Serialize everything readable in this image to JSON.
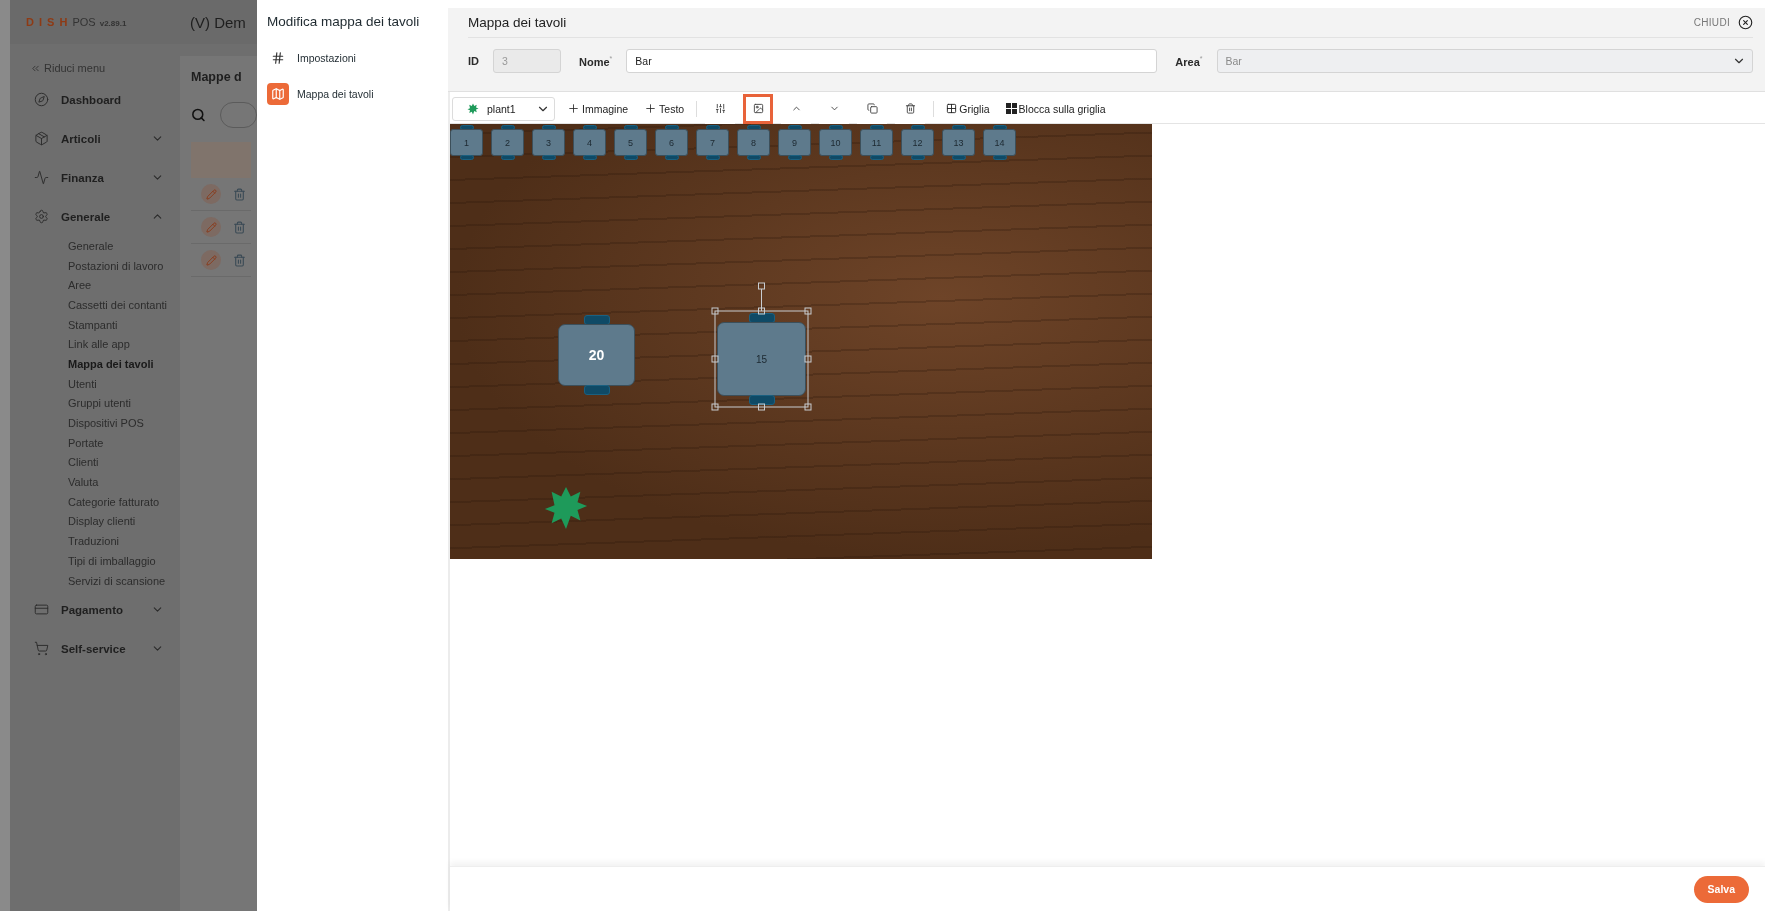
{
  "app": {
    "logo": {
      "brand": "D I S H",
      "product": "POS",
      "version": "v2.89.1"
    },
    "header_title": "(V) Dem",
    "sidebar": {
      "collapse": "Riduci menu",
      "items": [
        {
          "kind": "link",
          "label": "Dashboard"
        },
        {
          "kind": "group",
          "label": "Articoli",
          "expanded": false
        },
        {
          "kind": "group",
          "label": "Finanza",
          "expanded": false
        },
        {
          "kind": "group",
          "label": "Generale",
          "expanded": true,
          "children": [
            {
              "label": "Generale",
              "selected": false
            },
            {
              "label": "Postazioni di lavoro",
              "selected": false
            },
            {
              "label": "Aree",
              "selected": false
            },
            {
              "label": "Cassetti dei contanti",
              "selected": false
            },
            {
              "label": "Stampanti",
              "selected": false
            },
            {
              "label": "Link alle app",
              "selected": false
            },
            {
              "label": "Mappa dei tavoli",
              "selected": true
            },
            {
              "label": "Utenti",
              "selected": false
            },
            {
              "label": "Gruppi utenti",
              "selected": false
            },
            {
              "label": "Dispositivi POS",
              "selected": false
            },
            {
              "label": "Portate",
              "selected": false
            },
            {
              "label": "Clienti",
              "selected": false
            },
            {
              "label": "Valuta",
              "selected": false
            },
            {
              "label": "Categorie fatturato",
              "selected": false
            },
            {
              "label": "Display clienti",
              "selected": false
            },
            {
              "label": "Traduzioni",
              "selected": false
            },
            {
              "label": "Tipi di imballaggio",
              "selected": false
            },
            {
              "label": "Servizi di scansione",
              "selected": false
            }
          ]
        },
        {
          "kind": "group",
          "label": "Pagamento",
          "expanded": false
        },
        {
          "kind": "group",
          "label": "Self-service",
          "expanded": false
        }
      ]
    },
    "page": {
      "title": "Mappe d",
      "rows": [
        {
          "kind": "item"
        },
        {
          "kind": "item"
        },
        {
          "kind": "item"
        }
      ]
    }
  },
  "modal": {
    "title": "Modifica mappa dei tavoli",
    "nav": [
      {
        "label": "Impostazioni",
        "selected": false
      },
      {
        "label": "Mappa dei tavoli",
        "selected": true
      }
    ]
  },
  "editor": {
    "title": "Mappa dei tavoli",
    "close": "CHIUDI",
    "fields": [
      {
        "kind": "input",
        "label": "ID",
        "value": "3",
        "disabled": true
      },
      {
        "kind": "input",
        "label": "Nome$^{*}$",
        "value": "Bar",
        "disabled": false
      },
      {
        "kind": "select",
        "label": "Area$^{*}$",
        "value": "Bar",
        "disabled": true
      }
    ],
    "toolbar": {
      "element": "plant1",
      "items": [
        {
          "kind": "add",
          "label": "Immagine"
        },
        {
          "kind": "add",
          "label": "Testo"
        },
        {
          "kind": "icon",
          "highlighted": false
        },
        {
          "kind": "icon",
          "highlighted": true
        },
        {
          "kind": "icon",
          "highlighted": false
        },
        {
          "kind": "icon",
          "highlighted": false
        },
        {
          "kind": "icon",
          "highlighted": false
        },
        {
          "kind": "icon",
          "highlighted": false
        },
        {
          "kind": "grid",
          "label": "Griglia"
        },
        {
          "kind": "snap",
          "label": "Blocca sulla griglia"
        }
      ]
    },
    "canvas": {
      "tables": [
        {
          "kind": "bar",
          "label": "1",
          "selected": false
        },
        {
          "kind": "bar",
          "label": "2",
          "selected": false
        },
        {
          "kind": "bar",
          "label": "3",
          "selected": false
        },
        {
          "kind": "bar",
          "label": "4",
          "selected": false
        },
        {
          "kind": "bar",
          "label": "5",
          "selected": false
        },
        {
          "kind": "bar",
          "label": "6",
          "selected": false
        },
        {
          "kind": "bar",
          "label": "7",
          "selected": false
        },
        {
          "kind": "bar",
          "label": "8",
          "selected": false
        },
        {
          "kind": "bar",
          "label": "9",
          "selected": false
        },
        {
          "kind": "bar",
          "label": "10",
          "selected": false
        },
        {
          "kind": "bar",
          "label": "11",
          "selected": false
        },
        {
          "kind": "bar",
          "label": "12",
          "selected": false
        },
        {
          "kind": "bar",
          "label": "13",
          "selected": false
        },
        {
          "kind": "bar",
          "label": "14",
          "selected": false
        },
        {
          "kind": "dining",
          "label": "20",
          "selected": false
        },
        {
          "kind": "dining",
          "label": "15",
          "selected": true
        }
      ]
    },
    "save": "Salva"
  }
}
